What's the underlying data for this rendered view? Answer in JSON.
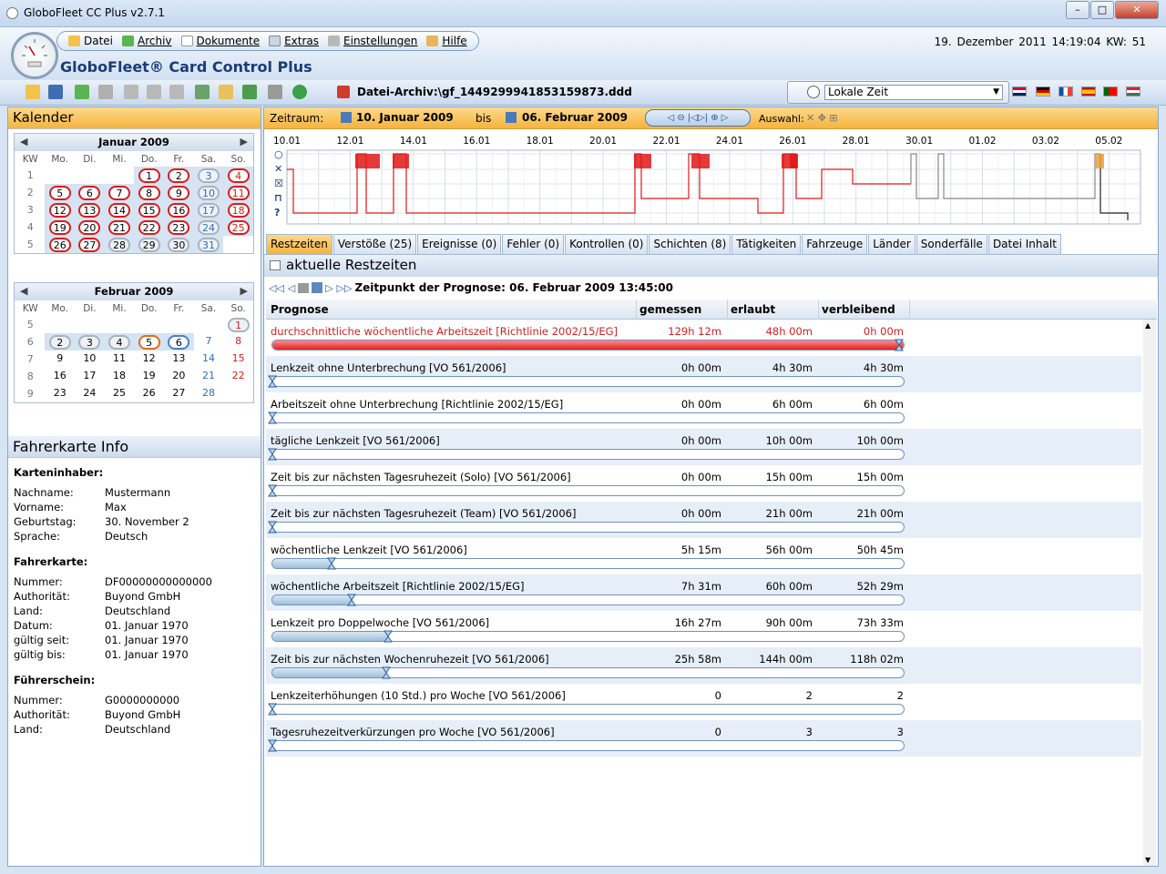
{
  "window": {
    "title": "GloboFleet CC Plus v2.7.1"
  },
  "menu": {
    "items": [
      "Datei",
      "Archiv",
      "Dokumente",
      "Extras",
      "Einstellungen",
      "Hilfe"
    ]
  },
  "brand": "GloboFleet® Card Control Plus",
  "datetime": "19. Dezember 2011   14:19:04   KW: 51",
  "file": "Datei-Archiv:\\gf_1449299941853159873.ddd",
  "timezone": "Lokale Zeit",
  "kalender": {
    "title": "Kalender",
    "month1": {
      "title": "Januar 2009",
      "headers": [
        "KW",
        "Mo.",
        "Di.",
        "Mi.",
        "Do.",
        "Fr.",
        "Sa.",
        "So."
      ],
      "rows": [
        [
          "1",
          "",
          "",
          "",
          "1",
          "2",
          "3",
          "4"
        ],
        [
          "2",
          "5",
          "6",
          "7",
          "8",
          "9",
          "10",
          "11"
        ],
        [
          "3",
          "12",
          "13",
          "14",
          "15",
          "16",
          "17",
          "18"
        ],
        [
          "4",
          "19",
          "20",
          "21",
          "22",
          "23",
          "24",
          "25"
        ],
        [
          "5",
          "26",
          "27",
          "28",
          "29",
          "30",
          "31",
          ""
        ]
      ]
    },
    "month2": {
      "title": "Februar 2009",
      "headers": [
        "KW",
        "Mo.",
        "Di.",
        "Mi.",
        "Do.",
        "Fr.",
        "Sa.",
        "So."
      ],
      "rows": [
        [
          "5",
          "",
          "",
          "",
          "",
          "",
          "",
          "1"
        ],
        [
          "6",
          "2",
          "3",
          "4",
          "5",
          "6",
          "7",
          "8"
        ],
        [
          "7",
          "9",
          "10",
          "11",
          "12",
          "13",
          "14",
          "15"
        ],
        [
          "8",
          "16",
          "17",
          "18",
          "19",
          "20",
          "21",
          "22"
        ],
        [
          "9",
          "23",
          "24",
          "25",
          "26",
          "27",
          "28",
          ""
        ]
      ]
    }
  },
  "info": {
    "title": "Fahrerkarte Info",
    "s1": "Karteninhaber:",
    "nachname_k": "Nachname:",
    "nachname": "Mustermann",
    "vorname_k": "Vorname:",
    "vorname": "Max",
    "geb_k": "Geburtstag:",
    "geb": "30. November 2",
    "spr_k": "Sprache:",
    "spr": "Deutsch",
    "s2": "Fahrerkarte:",
    "nr_k": "Nummer:",
    "nr": "DF00000000000000",
    "aut_k": "Authorität:",
    "aut": "Buyond GmbH",
    "land_k": "Land:",
    "land": "Deutschland",
    "dat_k": "Datum:",
    "dat": "01. Januar 1970",
    "gs_k": "gültig seit:",
    "gs": "01. Januar 1970",
    "gb_k": "gültig bis:",
    "gb": "01. Januar 1970",
    "s3": "Führerschein:",
    "fnr": "G0000000000",
    "faut": "Buyond GmbH",
    "fland": "Deutschland"
  },
  "zeitraum": {
    "label": "Zeitraum:",
    "from": "10. Januar 2009",
    "bis": "bis",
    "to": "06. Februar 2009",
    "auswahl": "Auswahl:"
  },
  "chart_data": {
    "type": "line",
    "x_ticks": [
      "10.01",
      "12.01",
      "14.01",
      "16.01",
      "18.01",
      "20.01",
      "22.01",
      "24.01",
      "26.01",
      "28.01",
      "30.01",
      "01.02",
      "03.02",
      "05.02"
    ]
  },
  "tabs": [
    "Restzeiten",
    "Verstöße (25)",
    "Ereignisse (0)",
    "Fehler (0)",
    "Kontrollen (0)",
    "Schichten (8)",
    "Tätigkeiten",
    "Fahrzeuge",
    "Länder",
    "Sonderfälle",
    "Datei Inhalt"
  ],
  "section_title": "aktuelle Restzeiten",
  "prognose": "Zeitpunkt der Prognose: 06. Februar 2009 13:45:00",
  "columns": [
    "Prognose",
    "gemessen",
    "erlaubt",
    "verbleibend"
  ],
  "rows": [
    {
      "name": "durchschnittliche wöchentliche Arbeitszeit [Richtlinie 2002/15/EG]",
      "gem": "129h 12m",
      "erl": "48h 00m",
      "ver": "0h 00m",
      "fill": 1.0,
      "red": true
    },
    {
      "name": "Lenkzeit ohne Unterbrechung [VO 561/2006]",
      "gem": "0h 00m",
      "erl": "4h 30m",
      "ver": "4h 30m",
      "fill": 0
    },
    {
      "name": "Arbeitszeit ohne Unterbrechung [Richtlinie 2002/15/EG]",
      "gem": "0h 00m",
      "erl": "6h 00m",
      "ver": "6h 00m",
      "fill": 0
    },
    {
      "name": "tägliche Lenkzeit [VO 561/2006]",
      "gem": "0h 00m",
      "erl": "10h 00m",
      "ver": "10h 00m",
      "fill": 0
    },
    {
      "name": "Zeit bis zur nächsten Tagesruhezeit (Solo) [VO 561/2006]",
      "gem": "0h 00m",
      "erl": "15h 00m",
      "ver": "15h 00m",
      "fill": 0
    },
    {
      "name": "Zeit bis zur nächsten Tagesruhezeit (Team) [VO 561/2006]",
      "gem": "0h 00m",
      "erl": "21h 00m",
      "ver": "21h 00m",
      "fill": 0
    },
    {
      "name": "wöchentliche Lenkzeit [VO 561/2006]",
      "gem": "5h 15m",
      "erl": "56h 00m",
      "ver": "50h 45m",
      "fill": 0.094
    },
    {
      "name": "wöchentliche Arbeitszeit [Richtlinie 2002/15/EG]",
      "gem": "7h 31m",
      "erl": "60h 00m",
      "ver": "52h 29m",
      "fill": 0.125
    },
    {
      "name": "Lenkzeit pro Doppelwoche [VO 561/2006]",
      "gem": "16h 27m",
      "erl": "90h 00m",
      "ver": "73h 33m",
      "fill": 0.183
    },
    {
      "name": "Zeit bis zur nächsten Wochenruhezeit [VO 561/2006]",
      "gem": "25h 58m",
      "erl": "144h 00m",
      "ver": "118h 02m",
      "fill": 0.18
    },
    {
      "name": "Lenkzeiterhöhungen (10 Std.) pro Woche [VO 561/2006]",
      "gem": "0",
      "erl": "2",
      "ver": "2",
      "fill": 0
    },
    {
      "name": "Tagesruhezeitverkürzungen pro Woche [VO 561/2006]",
      "gem": "0",
      "erl": "3",
      "ver": "3",
      "fill": 0
    }
  ]
}
